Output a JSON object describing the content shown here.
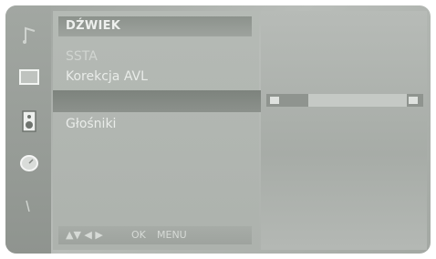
{
  "menu": {
    "header_title": "DŹWIEK",
    "items": [
      {
        "label": "SSTA"
      },
      {
        "label": "Korekcja AVL"
      },
      {
        "label": ""
      },
      {
        "label": "Głośniki"
      }
    ]
  },
  "footer": {
    "nav_arrows": "▲▼ ◀ ▶",
    "ok_label": "OK",
    "menu_label": "MENU"
  },
  "side_icons": [
    "music-note-icon",
    "picture-screen-icon",
    "speaker-icon",
    "clock-icon",
    "arrow-icon"
  ],
  "colors": {
    "panel": "#b5bab5",
    "highlight": "#7d837d"
  }
}
